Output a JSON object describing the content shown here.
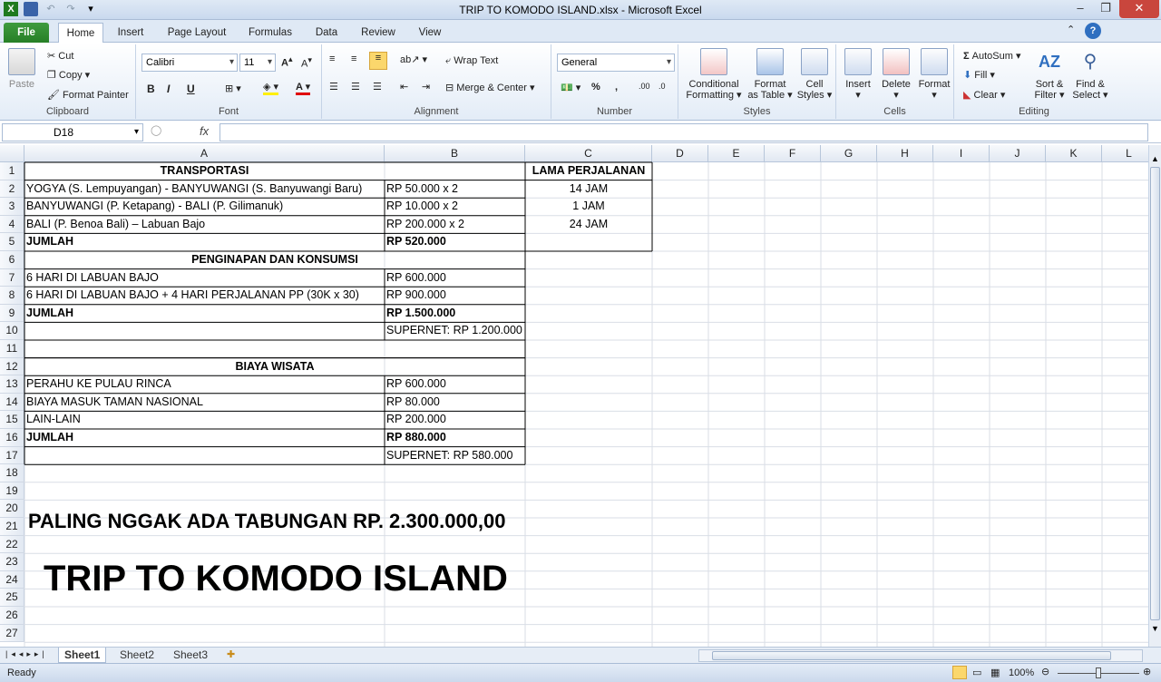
{
  "window": {
    "title": "TRIP TO KOMODO ISLAND.xlsx  -  Microsoft Excel"
  },
  "tabs": [
    "File",
    "Home",
    "Insert",
    "Page Layout",
    "Formulas",
    "Data",
    "Review",
    "View"
  ],
  "ribbon": {
    "clipboard": {
      "label": "Clipboard",
      "paste": "Paste",
      "cut": "Cut",
      "copy": "Copy",
      "format_painter": "Format Painter"
    },
    "font": {
      "label": "Font",
      "name": "Calibri",
      "size": "11"
    },
    "alignment": {
      "label": "Alignment",
      "wrap": "Wrap Text",
      "merge": "Merge & Center"
    },
    "number": {
      "label": "Number",
      "format": "General"
    },
    "styles": {
      "label": "Styles",
      "conditional": [
        "Conditional",
        "Formatting"
      ],
      "format_table": [
        "Format",
        "as Table"
      ],
      "cell_styles": [
        "Cell",
        "Styles"
      ]
    },
    "cells": {
      "label": "Cells",
      "insert": "Insert",
      "delete": "Delete",
      "format": "Format"
    },
    "editing": {
      "label": "Editing",
      "autosum": "AutoSum",
      "fill": "Fill",
      "clear": "Clear",
      "sort": [
        "Sort &",
        "Filter"
      ],
      "find": [
        "Find &",
        "Select"
      ]
    }
  },
  "formula_bar": {
    "name_box": "D18",
    "fx": "fx",
    "value": ""
  },
  "columns": [
    "A",
    "B",
    "C",
    "D",
    "E",
    "F",
    "G",
    "H",
    "I",
    "J",
    "K",
    "L"
  ],
  "rows": [
    "1",
    "2",
    "3",
    "4",
    "5",
    "6",
    "7",
    "8",
    "9",
    "10",
    "11",
    "12",
    "13",
    "14",
    "15",
    "16",
    "17",
    "18",
    "19",
    "20",
    "21",
    "22",
    "23",
    "24",
    "25",
    "26",
    "27"
  ],
  "cells": {
    "a1": "TRANSPORTASI",
    "c1": "LAMA PERJALANAN",
    "a2": " YOGYA (S. Lempuyangan) - BANYUWANGI (S. Banyuwangi Baru)",
    "b2": "RP 50.000 x 2",
    "c2": "14 JAM",
    "a3": "BANYUWANGI (P. Ketapang) - BALI (P. Gilimanuk)",
    "b3": "RP 10.000 x 2",
    "c3": "1 JAM",
    "a4": "BALI (P. Benoa Bali) – Labuan Bajo",
    "b4": "RP 200.000 x 2",
    "c4": "24 JAM",
    "a5": "JUMLAH",
    "b5": "RP 520.000",
    "a6": "PENGINAPAN DAN KONSUMSI",
    "a7": "6 HARI DI LABUAN BAJO",
    "b7": "RP 600.000",
    "a8": "6 HARI DI LABUAN BAJO + 4 HARI PERJALANAN PP (30K x 30)",
    "b8": "RP 900.000",
    "a9": "JUMLAH",
    "b9": "RP 1.500.000",
    "b10": "SUPERNET: RP 1.200.000",
    "a12": "BIAYA WISATA",
    "a13": "PERAHU KE PULAU RINCA",
    "b13": "RP 600.000",
    "a14": "BIAYA MASUK TAMAN NASIONAL",
    "b14": "RP 80.000",
    "a15": "LAIN-LAIN",
    "b15": "RP 200.000",
    "a16": "JUMLAH",
    "b16": "RP 880.000",
    "b17": "SUPERNET: RP 580.000",
    "a21": "PALING NGGAK ADA TABUNGAN RP. 2.300.000,00",
    "a24": "TRIP TO KOMODO ISLAND"
  },
  "sheets": [
    "Sheet1",
    "Sheet2",
    "Sheet3"
  ],
  "status": {
    "ready": "Ready",
    "zoom": "100%"
  }
}
